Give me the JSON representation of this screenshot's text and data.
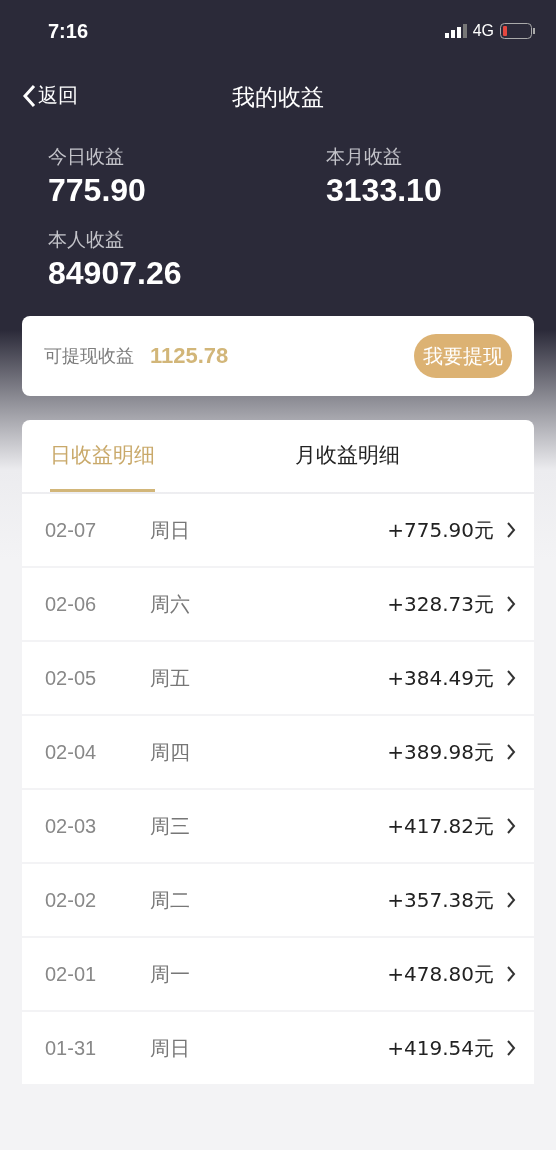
{
  "status_bar": {
    "time": "7:16",
    "network": "4G"
  },
  "nav": {
    "back": "返回",
    "title": "我的收益"
  },
  "stats": [
    {
      "label": "今日收益",
      "value": "775.90"
    },
    {
      "label": "本月收益",
      "value": "3133.10"
    },
    {
      "label": "本人收益",
      "value": "84907.26"
    }
  ],
  "withdraw": {
    "label": "可提现收益",
    "amount": "1125.78",
    "button": "我要提现"
  },
  "tabs": [
    {
      "label": "日收益明细",
      "selected": true
    },
    {
      "label": "月收益明细",
      "selected": false
    }
  ],
  "rows": [
    {
      "date": "02-07",
      "weekday": "周日",
      "amount": "+775.90元"
    },
    {
      "date": "02-06",
      "weekday": "周六",
      "amount": "+328.73元"
    },
    {
      "date": "02-05",
      "weekday": "周五",
      "amount": "+384.49元"
    },
    {
      "date": "02-04",
      "weekday": "周四",
      "amount": "+389.98元"
    },
    {
      "date": "02-03",
      "weekday": "周三",
      "amount": "+417.82元"
    },
    {
      "date": "02-02",
      "weekday": "周二",
      "amount": "+357.38元"
    },
    {
      "date": "02-01",
      "weekday": "周一",
      "amount": "+478.80元"
    },
    {
      "date": "01-31",
      "weekday": "周日",
      "amount": "+419.54元"
    }
  ]
}
